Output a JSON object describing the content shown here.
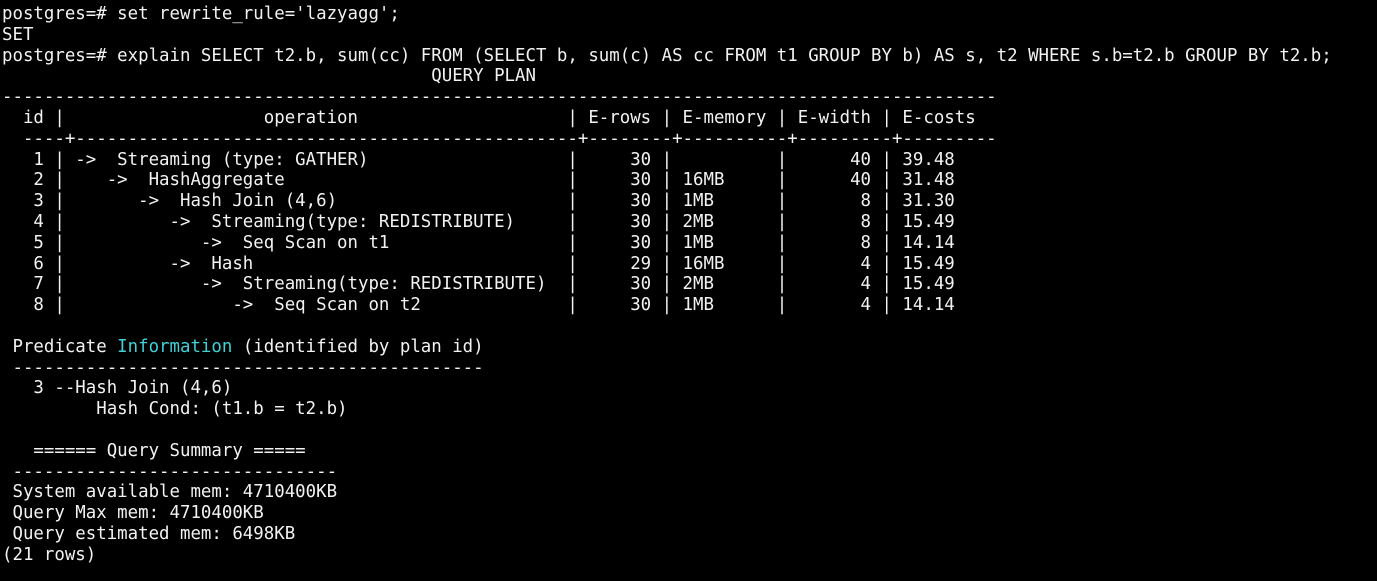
{
  "terminal": {
    "colors": {
      "background": "#000000",
      "text": "#f2f2f2",
      "highlight": "#3fd1d6"
    },
    "lines": [
      "postgres=# set rewrite_rule='lazyagg';",
      "SET",
      "postgres=# explain SELECT t2.b, sum(cc) FROM (SELECT b, sum(c) AS cc FROM t1 GROUP BY b) AS s, t2 WHERE s.b=t2.b GROUP BY t2.b;",
      "                                         QUERY PLAN",
      "-----------------------------------------------------------------------------------------------",
      "  id |                   operation                    | E-rows | E-memory | E-width | E-costs",
      "  ----+------------------------------------------------+--------+----------+---------+---------",
      "   1 | ->  Streaming (type: GATHER)                   |     30 |          |      40 | 39.48",
      "   2 |    ->  HashAggregate                           |     30 | 16MB     |      40 | 31.48",
      "   3 |       ->  Hash Join (4,6)                      |     30 | 1MB      |       8 | 31.30",
      "   4 |          ->  Streaming(type: REDISTRIBUTE)     |     30 | 2MB      |       8 | 15.49",
      "   5 |             ->  Seq Scan on t1                 |     30 | 1MB      |       8 | 14.14",
      "   6 |          ->  Hash                              |     29 | 16MB     |       4 | 15.49",
      "   7 |             ->  Streaming(type: REDISTRIBUTE)  |     30 | 2MB      |       4 | 15.49",
      "   8 |                ->  Seq Scan on t2              |     30 | 1MB      |       4 | 14.14",
      "",
      " Predicate ",
      " ---------------------------------------------",
      "   3 --Hash Join (4,6)",
      "         Hash Cond: (t1.b = t2.b)",
      "",
      "   ====== Query Summary =====",
      " -------------------------------",
      " System available mem: 4710400KB",
      " Query Max mem: 4710400KB",
      " Query estimated mem: 6498KB",
      "(21 rows)"
    ],
    "predicate_header": {
      "highlight_word": "Information",
      "suffix": " (identified by plan id)"
    }
  }
}
